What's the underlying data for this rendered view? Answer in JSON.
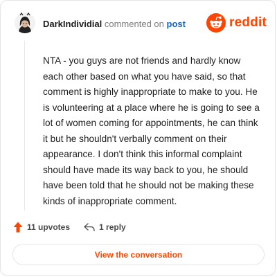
{
  "header": {
    "username": "DarkIndividial",
    "action_text": "commented on",
    "post_link": "post",
    "brand": "reddit"
  },
  "comment": {
    "body": "NTA - you guys are not friends and hardly know each other based on what you have said, so that comment is highly inappropriate to make to you. He is volunteering at a place where he is going to see a lot of women coming for appointments, he can think it but he shouldn't verbally comment on their appearance. I don't think this informal complaint should have made its way back to you, he should have been told that he should not be making these kinds of inappropriate comment."
  },
  "actions": {
    "upvotes_label": "11 upvotes",
    "reply_label": "1 reply"
  },
  "footer": {
    "view_conversation_label": "View the conversation"
  },
  "colors": {
    "brand_orange": "#ff4500",
    "link_blue": "#1c64c6"
  },
  "icons": {
    "avatar": "avatar-icon",
    "brand_logo": "reddit-logo-icon",
    "upvote": "upvote-arrow-icon",
    "reply": "reply-arrow-icon"
  }
}
